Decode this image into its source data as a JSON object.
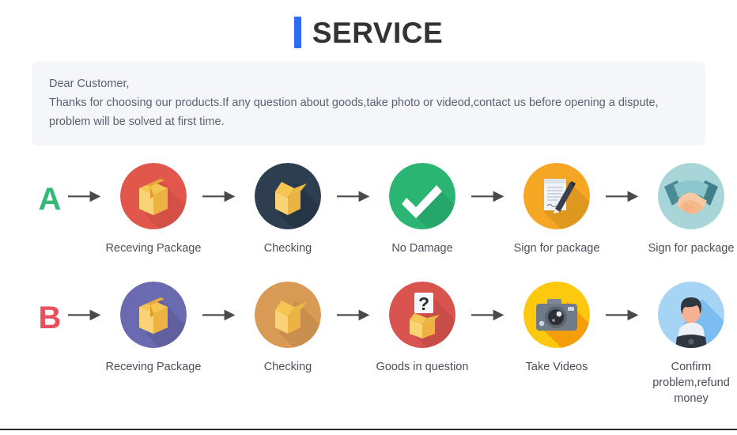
{
  "header": {
    "title": "SERVICE",
    "accent_color": "#2f6bf5"
  },
  "notice": {
    "background_color": "#f5f6fa",
    "lines": [
      "Dear Customer,",
      "Thanks for choosing our products.If any question about goods,take photo or videod,contact us before opening a dispute,",
      "problem will be solved at first time."
    ]
  },
  "flows": [
    {
      "letter": "A",
      "letter_color": "#34b877",
      "steps": [
        {
          "label": "Receving Package",
          "icon": "closed-box-icon",
          "circle_color": "#e2574c"
        },
        {
          "label": "Checking",
          "icon": "open-box-icon",
          "circle_color": "#2d3e50"
        },
        {
          "label": "No Damage",
          "icon": "check-mark-icon",
          "circle_color": "#2ab573"
        },
        {
          "label": "Sign for package",
          "icon": "document-pen-icon",
          "circle_color": "#f5a623"
        },
        {
          "label": "Sign for package",
          "icon": "handshake-icon",
          "circle_color": "#a8d5d8"
        }
      ]
    },
    {
      "letter": "B",
      "letter_color": "#e8505b",
      "steps": [
        {
          "label": "Receving Package",
          "icon": "closed-box-icon",
          "circle_color": "#6a6ab0"
        },
        {
          "label": "Checking",
          "icon": "open-box-icon",
          "circle_color": "#dd9council"
        },
        {
          "label": "Goods in question",
          "icon": "question-box-icon",
          "circle_color": "#d9534f"
        },
        {
          "label": "Take Videos",
          "icon": "camera-icon",
          "circle_color": "#fdc90f"
        },
        {
          "label": "Confirm problem,refund money",
          "icon": "person-avatar-icon",
          "circle_color": "#a5d4f5"
        }
      ]
    }
  ],
  "arrow": {
    "icon": "arrow-right-icon",
    "color": "#4a4a4a"
  }
}
